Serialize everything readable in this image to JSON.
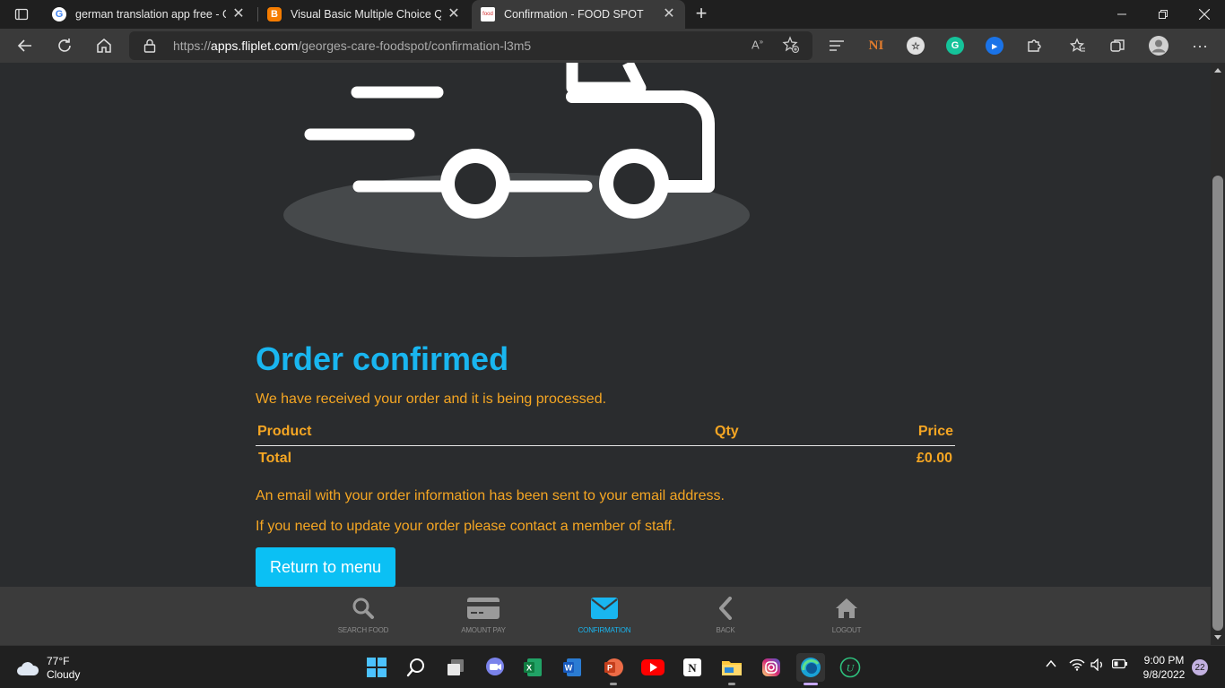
{
  "browser": {
    "tabs": [
      {
        "title": "german translation app free - Go",
        "favicon": "google-icon",
        "active": false
      },
      {
        "title": "Visual Basic Multiple Choice Que",
        "favicon": "blogger-icon",
        "active": false
      },
      {
        "title": "Confirmation - FOOD SPOT",
        "favicon": "foodspot-icon",
        "active": true
      }
    ],
    "address": {
      "scheme": "https://",
      "host": "apps.fliplet.com",
      "path": "/georges-care-foodspot/confirmation-l3m5"
    }
  },
  "page": {
    "heading": "Order confirmed",
    "received_message": "We have received your order and it is being processed.",
    "table": {
      "headers": {
        "product": "Product",
        "qty": "Qty",
        "price": "Price"
      },
      "total_label": "Total",
      "total_value": "£0.00"
    },
    "email_message": "An email with your order information has been sent to your email address.",
    "contact_message": "If you need to update your order please contact a member of staff.",
    "return_button": "Return to menu",
    "colors": {
      "accent": "#19b6f0",
      "text": "#f5a623",
      "background": "#2a2c2e"
    }
  },
  "app_nav": {
    "items": [
      {
        "label": "SEARCH FOOD",
        "icon": "search-icon"
      },
      {
        "label": "AMOUNT PAY",
        "icon": "credit-card-icon"
      },
      {
        "label": "CONFIRMATION",
        "icon": "envelope-icon",
        "active": true
      },
      {
        "label": "BACK",
        "icon": "chevron-left-icon"
      },
      {
        "label": "LOGOUT",
        "icon": "home-icon"
      }
    ]
  },
  "taskbar": {
    "weather": {
      "temp": "77°F",
      "condition": "Cloudy"
    },
    "clock": {
      "time": "9:00 PM",
      "date": "9/8/2022"
    },
    "notifications": "22"
  }
}
